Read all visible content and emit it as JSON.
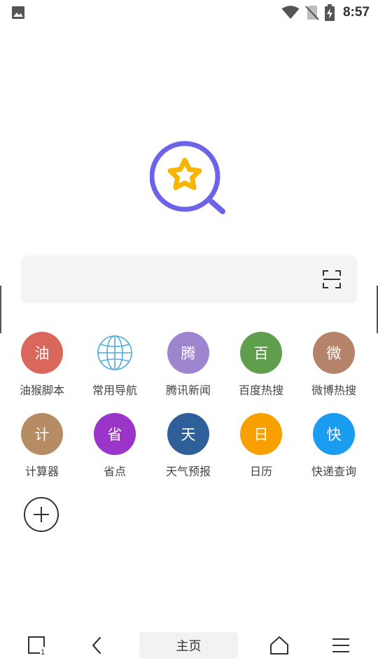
{
  "status_bar": {
    "time": "8:57",
    "icons": [
      "image-icon",
      "wifi-icon",
      "no-sim-icon",
      "battery-charging-icon"
    ]
  },
  "logo": {
    "icon": "search-star-logo-icon",
    "ring_color": "#6c63e8",
    "star_color": "#f7b500"
  },
  "search": {
    "value": "",
    "placeholder": "",
    "scan_icon": "scan-icon"
  },
  "shortcuts": [
    {
      "glyph": "油",
      "label": "油猴脚本",
      "color": "#d9675c"
    },
    {
      "glyph": "",
      "label": "常用导航",
      "color": "#4ea9dc",
      "icon": "globe-icon"
    },
    {
      "glyph": "腾",
      "label": "腾讯新闻",
      "color": "#9e86cf"
    },
    {
      "glyph": "百",
      "label": "百度热搜",
      "color": "#5f9e4c"
    },
    {
      "glyph": "微",
      "label": "微博热搜",
      "color": "#b4836a"
    },
    {
      "glyph": "计",
      "label": "计算器",
      "color": "#b58c63"
    },
    {
      "glyph": "省",
      "label": "省点",
      "color": "#9b35c9"
    },
    {
      "glyph": "天",
      "label": "天气预报",
      "color": "#2f5f98"
    },
    {
      "glyph": "日",
      "label": "日历",
      "color": "#f7a000"
    },
    {
      "glyph": "快",
      "label": "快递查询",
      "color": "#1a9cf0"
    }
  ],
  "add_shortcut": {
    "icon": "plus-icon"
  },
  "bottom_nav": {
    "tabs_count": "1",
    "home_label": "主页",
    "icons": [
      "tabs-icon",
      "back-icon",
      "home-icon",
      "menu-icon"
    ]
  }
}
